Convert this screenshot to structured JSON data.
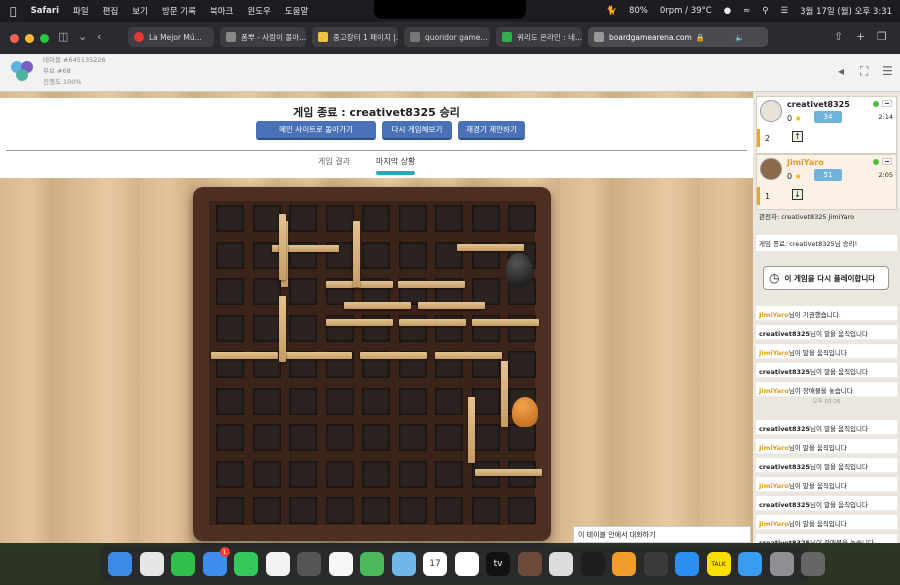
{
  "menubar": {
    "app": "Safari",
    "items": [
      "파일",
      "편집",
      "보기",
      "방문 기록",
      "북마크",
      "윈도우",
      "도움말"
    ],
    "battery": "80%",
    "fan": "0rpm / 39°C",
    "datetime": "3월 17일 (월) 오후 3:31"
  },
  "browser": {
    "tabs": [
      {
        "title": "La Mejor Mú...",
        "color": "#e53935"
      },
      {
        "title": "폼뿌 - 사람이 몰아...",
        "color": "#888"
      },
      {
        "title": "중고장터 1 페이지 |...",
        "color": "#f0c040"
      },
      {
        "title": "quoridor game...",
        "color": "#777"
      },
      {
        "title": "쿼리도 온라인 : 네...",
        "color": "#2db34a"
      },
      {
        "title": "boardgamearena.com",
        "color": "#999"
      }
    ]
  },
  "site": {
    "table_id": "테이블 #645135226",
    "move": "무브 #68",
    "progress": "진행도 100%"
  },
  "game": {
    "end_title": "게임 종료 : creativet8325 승리",
    "buttons": [
      "메인 사이트로 돌아가기",
      "다시 게임해보기",
      "재경기 제안하기"
    ],
    "tabs": [
      "게임 결과",
      "마지막 상황"
    ]
  },
  "players": [
    {
      "name": "creativet8325",
      "score": "0",
      "elo": "34",
      "time": "2:14",
      "walls": "2",
      "arrow": "↑",
      "flag_color": "#c60c30",
      "name_color": "#222"
    },
    {
      "name": "JimiYaro",
      "score": "0",
      "elo": "51",
      "time": "2:05",
      "walls": "1",
      "arrow": "↓",
      "flag_color": "#bc002d",
      "name_color": "#e39a20"
    }
  ],
  "spectators": "관전자:   creativet8325    JimiYaro",
  "chat": {
    "end": "게임 종료: creativet8325님 승리!",
    "replay": "이 게임을 다시 플레이합니다",
    "logs": [
      {
        "who": "JimiYaro",
        "msg": "님이 기권했습니다.",
        "orange": true
      },
      {
        "who": "creativet8325",
        "msg": "님이 말을 움직입니다",
        "orange": false
      },
      {
        "who": "JimiYaro",
        "msg": "님이 말을 움직입니다",
        "orange": true
      },
      {
        "who": "creativet8325",
        "msg": "님이 말을 움직입니다",
        "orange": false
      },
      {
        "who": "JimiYaro",
        "msg": "님이 장애물을 놓습니다",
        "orange": true
      },
      {
        "who": "creativet8325",
        "msg": "님이 말을 움직입니다",
        "orange": false
      },
      {
        "who": "JimiYaro",
        "msg": "님이 말을 움직입니다",
        "orange": true
      },
      {
        "who": "creativet8325",
        "msg": "님이 말을 움직입니다",
        "orange": false
      },
      {
        "who": "JimiYaro",
        "msg": "님이 말을 움직입니다",
        "orange": true
      },
      {
        "who": "creativet8325",
        "msg": "님이 말을 움직입니다",
        "orange": false
      },
      {
        "who": "JimiYaro",
        "msg": "님이 말을 움직입니다",
        "orange": true
      },
      {
        "who": "creativet8325",
        "msg": "님이 장애물을 놓습니다",
        "orange": false
      }
    ],
    "timestamp": "오후 03:26",
    "input": "이 테이블 안에서 대화하기"
  },
  "dock": [
    {
      "name": "finder",
      "color": "#3d8be8"
    },
    {
      "name": "launchpad",
      "color": "#e6e6e6"
    },
    {
      "name": "facetime",
      "color": "#2fbf4a"
    },
    {
      "name": "mail",
      "color": "#3e8ef0",
      "badge": "1"
    },
    {
      "name": "messages",
      "color": "#34c759"
    },
    {
      "name": "photos",
      "color": "#f2f2f2"
    },
    {
      "name": "calculator",
      "color": "#555"
    },
    {
      "name": "notes",
      "color": "#f7f7f7"
    },
    {
      "name": "findmy",
      "color": "#4bb95a"
    },
    {
      "name": "maps",
      "color": "#6fb7e8"
    },
    {
      "name": "calendar",
      "color": "#ffffff",
      "label": "17"
    },
    {
      "name": "clock",
      "color": "#ffffff"
    },
    {
      "name": "appletv",
      "color": "#111",
      "label": "tv"
    },
    {
      "name": "game",
      "color": "#6b4a3a"
    },
    {
      "name": "chrome",
      "color": "#ddd"
    },
    {
      "name": "arc",
      "color": "#1e1e1e"
    },
    {
      "name": "pages",
      "color": "#f29a2a"
    },
    {
      "name": "keynote",
      "color": "#3b3b3b"
    },
    {
      "name": "appstore",
      "color": "#2a8ff0"
    },
    {
      "name": "kakaotalk",
      "color": "#f9e000",
      "label": "TALK"
    },
    {
      "name": "safari",
      "color": "#3a9cf0"
    },
    {
      "name": "settings",
      "color": "#8e8e93"
    },
    {
      "name": "trash",
      "color": "#666"
    }
  ]
}
